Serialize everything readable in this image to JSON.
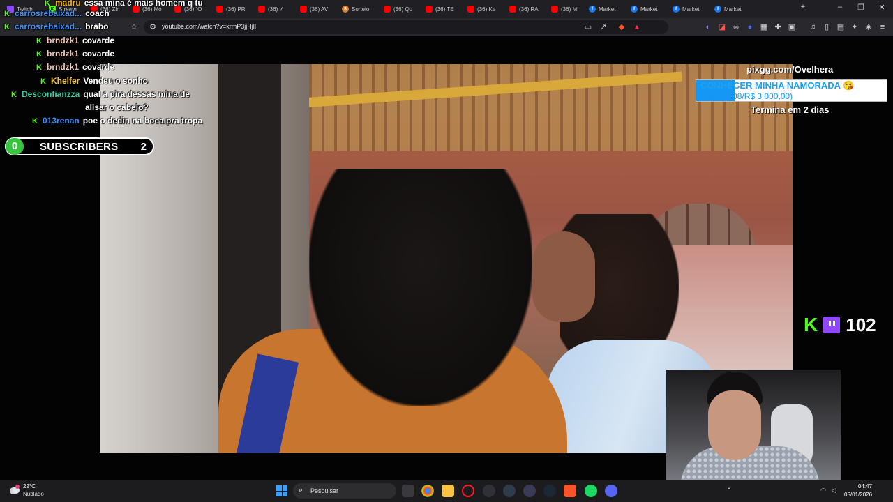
{
  "browser": {
    "tabs": [
      {
        "label": "Twitch",
        "icon": "twitch-icon"
      },
      {
        "label": "Stream",
        "icon": "kick-icon"
      },
      {
        "label": "(36) Zin",
        "icon": "youtube-icon"
      },
      {
        "label": "(36) Mo",
        "icon": "youtube-icon"
      },
      {
        "label": "(36) \"O",
        "icon": "youtube-icon"
      },
      {
        "label": "(36) PR",
        "icon": "youtube-icon"
      },
      {
        "label": "(36) И",
        "icon": "youtube-icon"
      },
      {
        "label": "(36) AV",
        "icon": "youtube-icon"
      },
      {
        "label": "Sorteio",
        "icon": "sorteio-icon"
      },
      {
        "label": "(36) Qu",
        "icon": "youtube-icon"
      },
      {
        "label": "(36) TE",
        "icon": "youtube-icon"
      },
      {
        "label": "(36) Ke",
        "icon": "youtube-icon"
      },
      {
        "label": "(36) RA",
        "icon": "youtube-icon"
      },
      {
        "label": "(36) MI",
        "icon": "youtube-icon"
      },
      {
        "label": "Market",
        "icon": "facebook-icon"
      },
      {
        "label": "Market",
        "icon": "facebook-icon"
      },
      {
        "label": "Market",
        "icon": "facebook-icon"
      },
      {
        "label": "Market",
        "icon": "facebook-icon"
      }
    ],
    "new_tab": "+",
    "url": "youtube.com/watch?v=krmP3jjHjlI"
  },
  "chat": {
    "messages": [
      {
        "user": "madru",
        "text": "essa mina é mais homem q tu",
        "user_color": "#f4b400"
      },
      {
        "user": "carrosrebaixad...",
        "text": "coach",
        "user_color": "#3e8ef7"
      },
      {
        "user": "carrosrebaixad...",
        "text": "brabo",
        "user_color": "#3e8ef7"
      },
      {
        "user": "brndzk1",
        "text": "covarde",
        "user_color": "#f2c9b8"
      },
      {
        "user": "brndzk1",
        "text": "covarde",
        "user_color": "#f2c9b8"
      },
      {
        "user": "brndzk1",
        "text": "covarde",
        "user_color": "#f2c9b8"
      },
      {
        "user": "Khelfer",
        "text": "Vendeu o sonho",
        "user_color": "#f4c542"
      },
      {
        "user": "Desconfianzza",
        "text": "qual a pira dessas mina de",
        "text2": "alisar o cabelo?",
        "user_color": "#3ec7a6"
      },
      {
        "user": "013renan",
        "text": "poe o dedin na boca pra tropa",
        "user_color": "#3e8ef7"
      }
    ]
  },
  "subscribers": {
    "left": "0",
    "label": "SUBSCRIBERS",
    "right": "2"
  },
  "goal": {
    "site": "pixgg.com/Ovelhera",
    "title": "CONHECER MINHA NAMORADA 😘",
    "amount": "(R$ 606,08/R$ 3.000,00)",
    "progress": 0.2,
    "ends": "Termina em 2 dias"
  },
  "viewers": {
    "count": "102"
  },
  "taskbar": {
    "temperature": "22°C",
    "condition": "Nublado",
    "search_placeholder": "Pesquisar",
    "time": "04:47",
    "date": "05/01/2026"
  },
  "colors": {
    "kick_green": "#53fc18",
    "twitch_purple": "#9146ff",
    "goal_blue": "#1597f4",
    "sub_green": "#38c43f"
  }
}
